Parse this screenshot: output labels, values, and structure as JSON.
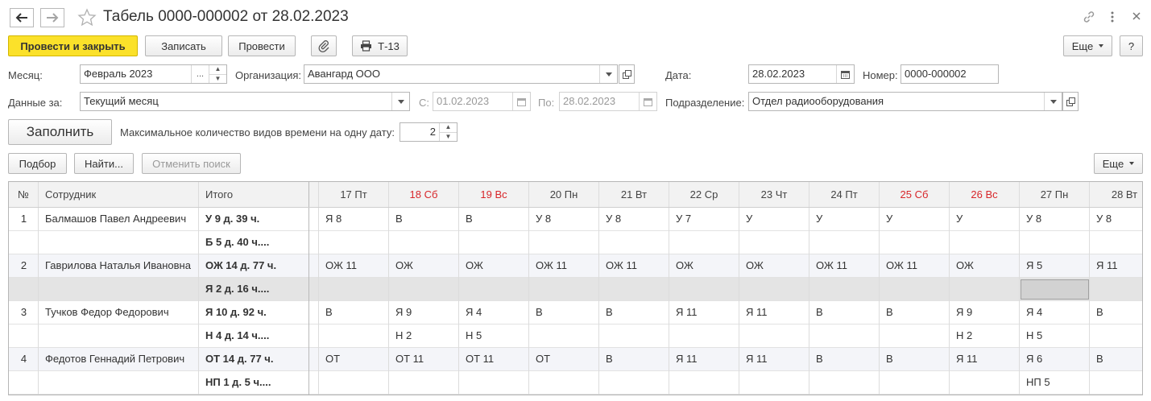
{
  "window": {
    "title": "Табель 0000-000002 от 28.02.2023"
  },
  "toolbar": {
    "post_close": "Провести и закрыть",
    "save": "Записать",
    "post": "Провести",
    "t13": "Т-13",
    "more": "Еще",
    "help": "?"
  },
  "form": {
    "month_label": "Месяц:",
    "month_value": "Февраль 2023",
    "org_label": "Организация:",
    "org_value": "Авангард ООО",
    "date_label": "Дата:",
    "date_value": "28.02.2023",
    "number_label": "Номер:",
    "number_value": "0000-000002",
    "data_label": "Данные за:",
    "data_value": "Текущий месяц",
    "from_label": "С:",
    "from_value": "01.02.2023",
    "to_label": "По:",
    "to_value": "28.02.2023",
    "dept_label": "Подразделение:",
    "dept_value": "Отдел радиооборудования",
    "fill": "Заполнить",
    "max_label": "Максимальное количество видов времени на одну дату:",
    "max_value": "2"
  },
  "tablebar": {
    "pick": "Подбор",
    "find": "Найти...",
    "cancel_search": "Отменить поиск",
    "more": "Еще"
  },
  "table": {
    "headers": {
      "num": "№",
      "employee": "Сотрудник",
      "total": "Итого"
    },
    "days": [
      {
        "label": "17 Пт",
        "weekend": false
      },
      {
        "label": "18 Сб",
        "weekend": true
      },
      {
        "label": "19 Вс",
        "weekend": true
      },
      {
        "label": "20 Пн",
        "weekend": false
      },
      {
        "label": "21 Вт",
        "weekend": false
      },
      {
        "label": "22 Ср",
        "weekend": false
      },
      {
        "label": "23 Чт",
        "weekend": false
      },
      {
        "label": "24 Пт",
        "weekend": false
      },
      {
        "label": "25 Сб",
        "weekend": true
      },
      {
        "label": "26 Вс",
        "weekend": true
      },
      {
        "label": "27 Пн",
        "weekend": false
      },
      {
        "label": "28 Вт",
        "weekend": false
      }
    ],
    "rows": [
      {
        "num": "1",
        "employee": "Балмашов Павел Андреевич",
        "total": "У 9 д. 39 ч.",
        "days": [
          "Я 8",
          "В",
          "В",
          "У 8",
          "У 8",
          "У 7",
          "У",
          "У",
          "У",
          "У",
          "У 8",
          "У 8"
        ]
      },
      {
        "num": "",
        "employee": "",
        "total": "Б 5 д. 40 ч....",
        "days": [
          "",
          "",
          "",
          "",
          "",
          "",
          "",
          "",
          "",
          "",
          "",
          ""
        ]
      },
      {
        "num": "2",
        "employee": "Гаврилова Наталья Ивановна",
        "total": "ОЖ 14 д. 77 ч.",
        "days": [
          "ОЖ 11",
          "ОЖ",
          "ОЖ",
          "ОЖ 11",
          "ОЖ 11",
          "ОЖ",
          "ОЖ",
          "ОЖ 11",
          "ОЖ 11",
          "ОЖ",
          "Я 5",
          "Я 11"
        ]
      },
      {
        "num": "",
        "employee": "",
        "total": "Я 2 д. 16 ч....",
        "days": [
          "",
          "",
          "",
          "",
          "",
          "",
          "",
          "",
          "",
          "",
          "",
          ""
        ]
      },
      {
        "num": "3",
        "employee": "Тучков Федор Федорович",
        "total": "Я 10 д. 92 ч.",
        "days": [
          "В",
          "Я 9",
          "Я 4",
          "В",
          "В",
          "Я 11",
          "Я 11",
          "В",
          "В",
          "Я 9",
          "Я 4",
          "В"
        ]
      },
      {
        "num": "",
        "employee": "",
        "total": "Н 4 д. 14 ч....",
        "days": [
          "",
          "Н 2",
          "Н 5",
          "",
          "",
          "",
          "",
          "",
          "",
          "Н 2",
          "Н 5",
          ""
        ]
      },
      {
        "num": "4",
        "employee": "Федотов Геннадий Петрович",
        "total": "ОТ 14 д. 77 ч.",
        "days": [
          "ОТ",
          "ОТ 11",
          "ОТ 11",
          "ОТ",
          "В",
          "Я 11",
          "Я 11",
          "В",
          "В",
          "Я 11",
          "Я 6",
          "В"
        ]
      },
      {
        "num": "",
        "employee": "",
        "total": "НП 1 д. 5 ч....",
        "days": [
          "",
          "",
          "",
          "",
          "",
          "",
          "",
          "",
          "",
          "",
          "НП 5",
          ""
        ]
      }
    ]
  },
  "colors": {
    "accent": "#fbe12a",
    "weekend": "#d8262a",
    "row_alt": "#f4f5f9",
    "row_selected": "#e4e4e4"
  },
  "icons": [
    "back-arrow-icon",
    "forward-arrow-icon",
    "star-icon",
    "link-icon",
    "kebab-menu-icon",
    "close-icon",
    "paperclip-icon",
    "printer-icon",
    "calendar-icon",
    "open-icon"
  ]
}
